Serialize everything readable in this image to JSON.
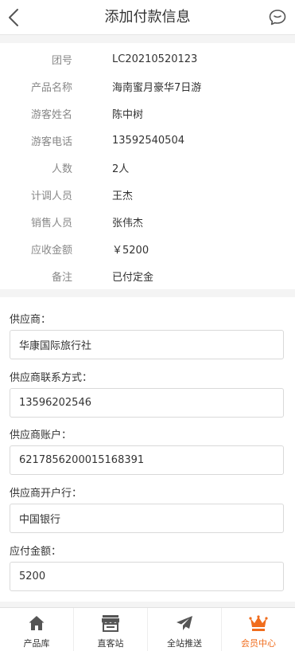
{
  "header": {
    "title": "添加付款信息",
    "back_icon": "chevron-left-icon",
    "message_icon": "chat-bubble-icon"
  },
  "info": [
    {
      "label": "团号",
      "value": "LC20210520123"
    },
    {
      "label": "产品名称",
      "value": "海南蜜月豪华7日游"
    },
    {
      "label": "游客姓名",
      "value": "陈中树"
    },
    {
      "label": "游客电话",
      "value": "13592540504"
    },
    {
      "label": "人数",
      "value": "2人"
    },
    {
      "label": "计调人员",
      "value": "王杰"
    },
    {
      "label": "销售人员",
      "value": "张伟杰"
    },
    {
      "label": "应收金额",
      "value": "￥5200"
    },
    {
      "label": "备注",
      "value": "已付定金"
    }
  ],
  "form": {
    "supplier": {
      "label": "供应商：",
      "value": "华康国际旅行社"
    },
    "supplier_contact": {
      "label": "供应商联系方式：",
      "value": "13596202546"
    },
    "supplier_account": {
      "label": "供应商账户：",
      "value": "6217856200015168391"
    },
    "supplier_bank": {
      "label": "供应商开户行：",
      "value": "中国银行"
    },
    "amount_payable": {
      "label": "应付金额：",
      "value": "5200"
    }
  },
  "tabbar": {
    "items": [
      {
        "label": "产品库",
        "icon": "home-icon"
      },
      {
        "label": "直客站",
        "icon": "storefront-icon"
      },
      {
        "label": "全站推送",
        "icon": "paper-plane-icon"
      },
      {
        "label": "会员中心",
        "icon": "crown-icon"
      }
    ],
    "active_index": 3
  },
  "colors": {
    "accent": "#f06c1c",
    "background": "#f4f4f4",
    "icon": "#555555"
  }
}
